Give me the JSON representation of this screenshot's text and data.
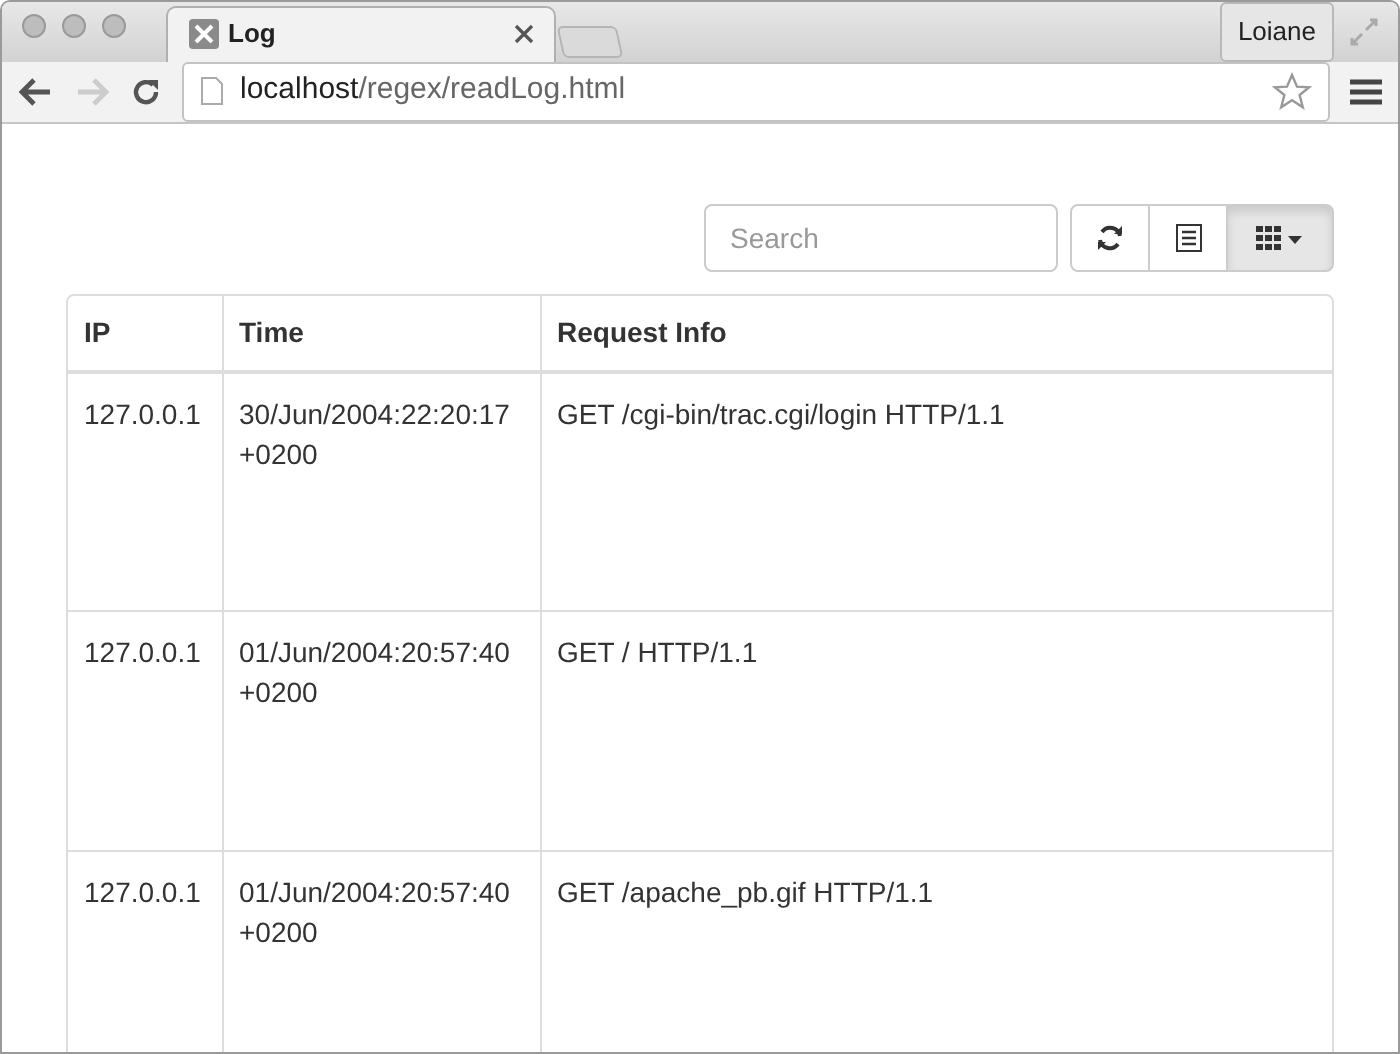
{
  "window": {
    "tabs": [
      {
        "title": "Log",
        "selected": true
      }
    ],
    "profile": "Loiane"
  },
  "address_bar": {
    "url": "**localhost**/regex/readLog.html"
  },
  "toolbar": {
    "search": {
      "placeholder": "Search"
    },
    "buttons": [
      {
        "kind": "refresh",
        "pressed": false
      },
      {
        "kind": "list",
        "pressed": false
      },
      {
        "kind": "columns",
        "pressed": true
      }
    ]
  },
  "table": {
    "columns": [
      "IP",
      "Time",
      "Request Info"
    ],
    "rows": [
      {
        "cells": [
          "127.0.0.1",
          "30/Jun/2004:22:20:17 +0200",
          "GET /cgi-bin/trac.cgi/login HTTP/1.1"
        ]
      },
      {
        "cells": [
          "127.0.0.1",
          "01/Jun/2004:20:57:40 +0200",
          "GET / HTTP/1.1"
        ]
      },
      {
        "cells": [
          "127.0.0.1",
          "01/Jun/2004:20:57:40 +0200",
          "GET /apache_pb.gif HTTP/1.1"
        ]
      }
    ]
  }
}
